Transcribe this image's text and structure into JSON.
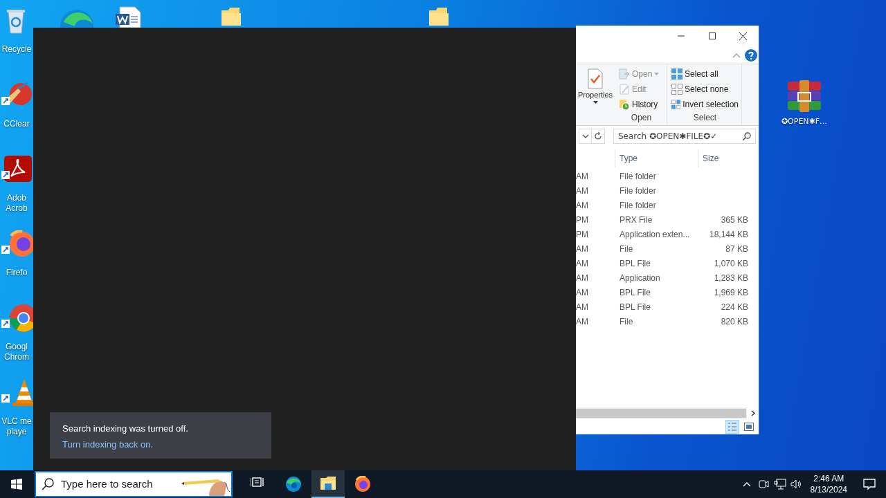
{
  "desktop_icons": [
    {
      "kind": "recycle",
      "shortcut": false,
      "label_lines": [
        "Recycle"
      ]
    },
    {
      "kind": "ccleaner",
      "shortcut": true,
      "label_lines": [
        "CClear"
      ]
    },
    {
      "kind": "acrobat",
      "shortcut": true,
      "label_lines": [
        "Adob",
        "Acrob"
      ]
    },
    {
      "kind": "firefox",
      "shortcut": true,
      "label_lines": [
        "Firefo"
      ]
    },
    {
      "kind": "chrome",
      "shortcut": true,
      "label_lines": [
        "Googl",
        "Chrom"
      ]
    },
    {
      "kind": "vlc",
      "shortcut": true,
      "label_lines": [
        "VLC me",
        "playe"
      ]
    }
  ],
  "desktop_file": {
    "label": "✪OPEN✱F…"
  },
  "search_panel": {
    "notice": {
      "message": "Search indexing was turned off.",
      "link": "Turn indexing back on."
    }
  },
  "explorer": {
    "ribbon": {
      "properties_label": "Properties",
      "groups": [
        {
          "label": "Open",
          "items": [
            {
              "kind": "open",
              "label": "Open",
              "disabled": true,
              "dropdown": true
            },
            {
              "kind": "edit",
              "label": "Edit",
              "disabled": true,
              "dropdown": false
            },
            {
              "kind": "history",
              "label": "History",
              "disabled": false,
              "dropdown": false
            }
          ]
        },
        {
          "label": "Select",
          "items": [
            {
              "kind": "select-all",
              "label": "Select all",
              "disabled": false,
              "dropdown": false
            },
            {
              "kind": "select-none",
              "label": "Select none",
              "disabled": false,
              "dropdown": false
            },
            {
              "kind": "invert",
              "label": "Invert selection",
              "disabled": false,
              "dropdown": false
            }
          ]
        }
      ]
    },
    "search": {
      "placeholder": "Search ✪OPEN✱FILE✪✓"
    },
    "columns": [
      "Type",
      "Size"
    ],
    "rows": [
      {
        "column_1": "AM",
        "type": "File folder"
      },
      {
        "column_1": "AM",
        "type": "File folder"
      },
      {
        "column_1": "AM",
        "type": "File folder"
      },
      {
        "column_1": "PM",
        "type": "PRX File",
        "size": "365 KB"
      },
      {
        "column_1": "PM",
        "type": "Application exten...",
        "size": "18,144 KB"
      },
      {
        "column_1": "AM",
        "type": "File",
        "size": "87 KB"
      },
      {
        "column_1": "AM",
        "type": "BPL File",
        "size": "1,070 KB"
      },
      {
        "column_1": "AM",
        "type": "Application",
        "size": "1,283 KB"
      },
      {
        "column_1": "AM",
        "type": "BPL File",
        "size": "1,969 KB"
      },
      {
        "column_1": "AM",
        "type": "BPL File",
        "size": "224 KB"
      },
      {
        "column_1": "AM",
        "type": "File",
        "size": "820 KB"
      }
    ]
  },
  "taskbar": {
    "search_placeholder": "Type here to search",
    "apps": [
      {
        "kind": "task-view",
        "active": false
      },
      {
        "kind": "edge",
        "active": false
      },
      {
        "kind": "explorer",
        "active": true
      },
      {
        "kind": "firefox",
        "active": false
      }
    ],
    "time": "2:46 AM",
    "date": "8/13/2024"
  }
}
